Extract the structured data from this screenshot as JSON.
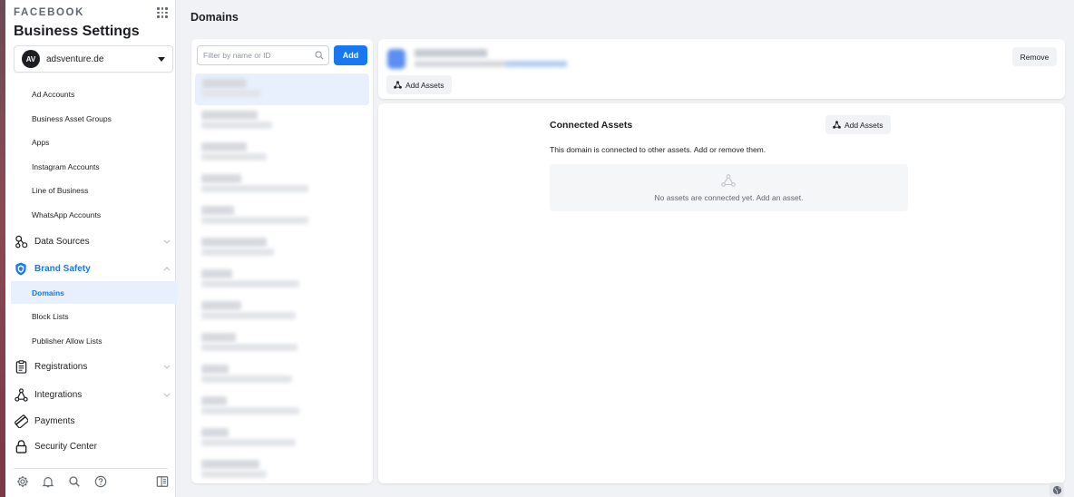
{
  "brand": {
    "wordmark": "FACEBOOK",
    "title": "Business Settings"
  },
  "account": {
    "avatar_text": "AV",
    "name": "adsventure.de"
  },
  "sidebar": {
    "accounts_subitems": [
      {
        "label": "Ad Accounts"
      },
      {
        "label": "Business Asset Groups"
      },
      {
        "label": "Apps"
      },
      {
        "label": "Instagram Accounts"
      },
      {
        "label": "Line of Business"
      },
      {
        "label": "WhatsApp Accounts"
      }
    ],
    "data_sources": {
      "label": "Data Sources",
      "icon": "data-sources-icon"
    },
    "brand_safety": {
      "label": "Brand Safety",
      "icon": "shield-icon",
      "subitems": [
        {
          "label": "Domains",
          "active": true
        },
        {
          "label": "Block Lists"
        },
        {
          "label": "Publisher Allow Lists"
        }
      ]
    },
    "registrations": {
      "label": "Registrations",
      "icon": "clipboard-icon"
    },
    "integrations": {
      "label": "Integrations",
      "icon": "integrations-icon"
    },
    "payments": {
      "label": "Payments",
      "icon": "credit-card-icon"
    },
    "security_center": {
      "label": "Security Center",
      "icon": "lock-icon"
    },
    "bottom_icons": [
      "gear-icon",
      "bell-icon",
      "search-icon",
      "help-icon",
      "panel-toggle-icon"
    ]
  },
  "page": {
    "title": "Domains"
  },
  "list": {
    "search_placeholder": "Filter by name or ID",
    "add_label": "Add"
  },
  "detail": {
    "remove_label": "Remove",
    "add_assets_label": "Add Assets"
  },
  "connected_assets": {
    "title": "Connected Assets",
    "add_assets_label": "Add Assets",
    "description": "This domain is connected to other assets. Add or remove them.",
    "empty_text": "No assets are connected yet. Add an asset."
  },
  "colors": {
    "accent": "#1877f2",
    "active_bg": "#e7f0fc",
    "page_bg": "#f0f2f5"
  }
}
